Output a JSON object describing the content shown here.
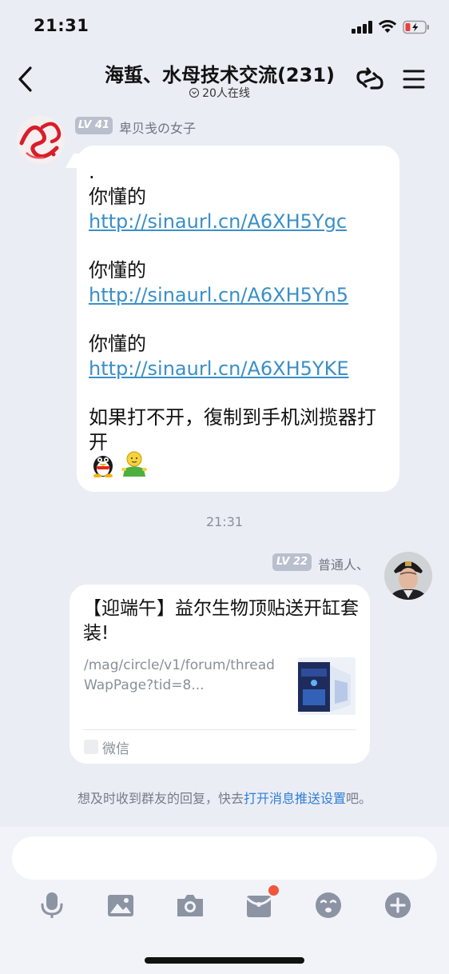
{
  "status": {
    "time": "21:31"
  },
  "nav": {
    "title": "海蜇、水母技术交流(231)",
    "online": "20人在线"
  },
  "messages": [
    {
      "level": "LV 41",
      "sender": "卑贝戋の女子",
      "lines": [
        {
          "text": "."
        },
        {
          "prefix": "你懂的 ",
          "link": "http://sinaurl.cn/A6XH5Ygc"
        },
        {
          "prefix": "你懂的 ",
          "link": "http://sinaurl.cn/A6XH5Yn5"
        },
        {
          "prefix": "你懂的 ",
          "link": "http://sinaurl.cn/A6XH5YKE"
        },
        {
          "text": "如果打不开，復制到手机浏揽器打开"
        }
      ]
    },
    {
      "level": "LV 22",
      "sender": "普通人、",
      "card": {
        "title": "【迎端午】益尔生物顶贴送开缸套装!",
        "url": "/mag/circle/v1/forum/threadWapPage?tid=8...",
        "source": "微信"
      }
    }
  ],
  "timestamp": "21:31",
  "notice": {
    "prefix": "想及时收到群友的回复，快去",
    "link": "打开消息推送设置",
    "suffix": "吧。"
  },
  "toolbar": [
    "mic-icon",
    "image-icon",
    "camera-icon",
    "red-packet-icon",
    "emoji-icon",
    "plus-icon"
  ],
  "colors": {
    "link": "#3a8fc7",
    "accent": "#2f7fd6",
    "badge": "#b9bfcc",
    "notify_dot": "#f0563c"
  }
}
